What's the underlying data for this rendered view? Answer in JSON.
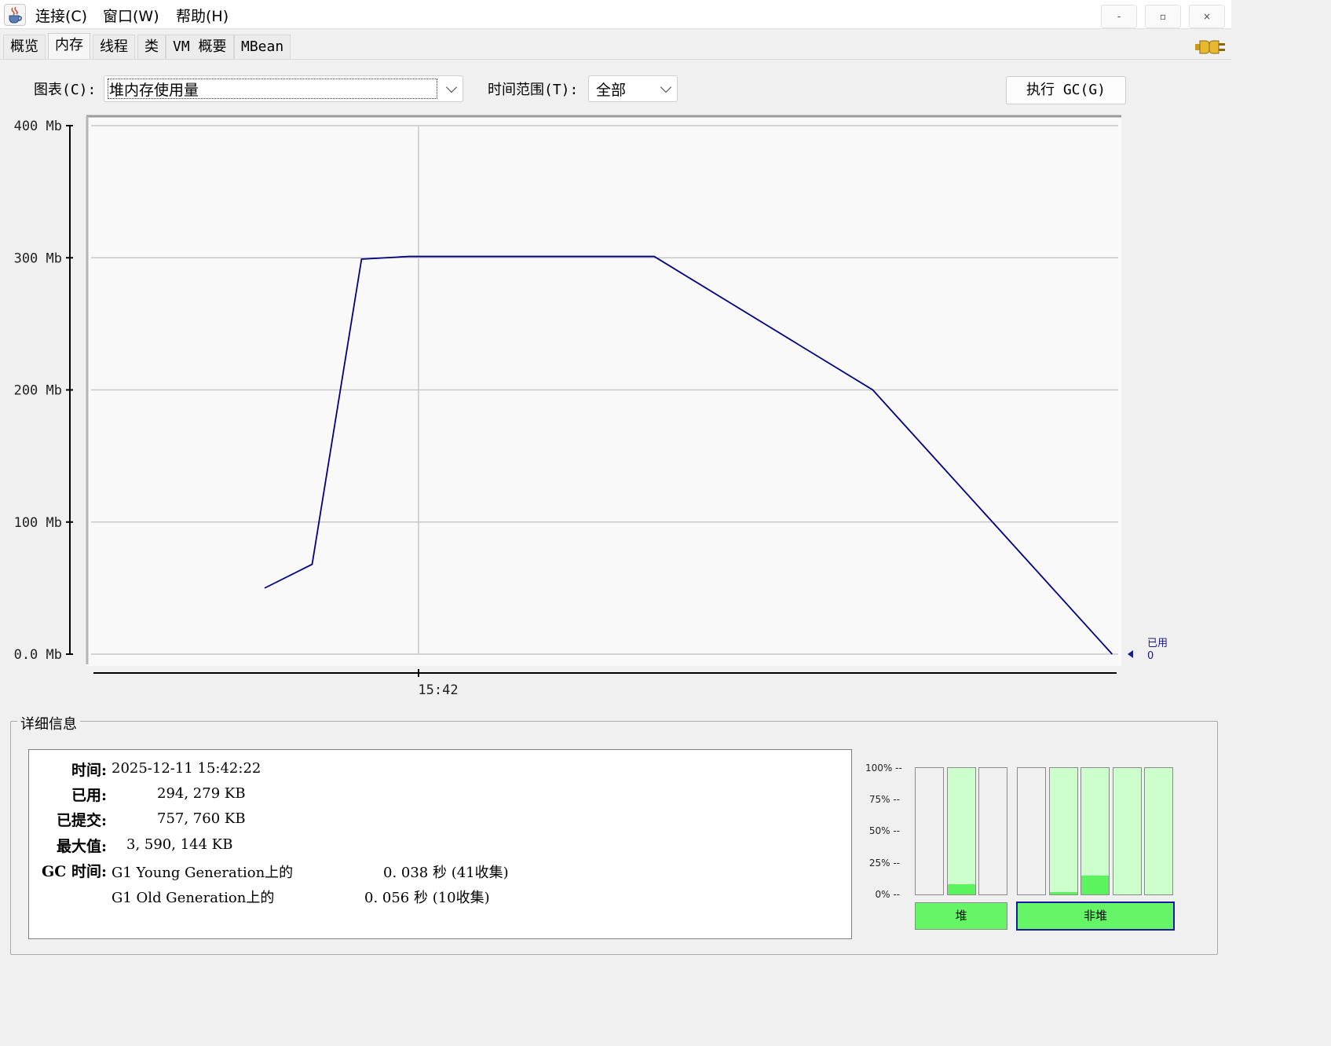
{
  "menu": {
    "items": [
      "连接(C)",
      "窗口(W)",
      "帮助(H)"
    ]
  },
  "window_controls": {
    "minimize": "-",
    "restore": "▫",
    "close": "×"
  },
  "tabs": [
    "概览",
    "内存",
    "线程",
    "类",
    "VM 概要",
    "MBean"
  ],
  "active_tab": "内存",
  "controls": {
    "chart_label": "图表(C):",
    "chart_value": "堆内存使用量",
    "range_label": "时间范围(T):",
    "range_value": "全部",
    "gc_button": "执行 GC(G)"
  },
  "chart_data": {
    "type": "line",
    "y_ticks": [
      "400 Mb",
      "300 Mb",
      "200 Mb",
      "100 Mb",
      "0.0 Mb"
    ],
    "ylim": [
      0,
      400
    ],
    "x_tick_labels": [
      "15:42"
    ],
    "grid": true,
    "line_color": "#000080",
    "series": [
      {
        "name": "已用",
        "points": [
          [
            0.0,
            50
          ],
          [
            0.25,
            68
          ],
          [
            0.51,
            299
          ],
          [
            0.76,
            301
          ],
          [
            2.05,
            301
          ],
          [
            3.2,
            200
          ],
          [
            4.46,
            0
          ]
        ]
      }
    ],
    "x_marker_label": "15:42",
    "legend": {
      "label": "已用",
      "value": "0",
      "position": "right"
    }
  },
  "details": {
    "title": "详细信息",
    "rows": [
      {
        "label": "时间:",
        "value": "2025-12-11 15:42:22"
      },
      {
        "label": "已用:",
        "value": "294, 279 KB"
      },
      {
        "label": "已提交:",
        "value": "757, 760 KB"
      },
      {
        "label": "最大值:",
        "value": "3, 590, 144 KB"
      }
    ],
    "gc_label": "GC 时间:",
    "gc": [
      {
        "name": "G1 Young Generation上的",
        "time": "0. 038 秒 (41收集)"
      },
      {
        "name": "G1 Old Generation上的",
        "time": "0. 056 秒 (10收集)"
      }
    ]
  },
  "pools": {
    "percent_ticks": [
      "100% --",
      "75% --",
      "50% --",
      "25% --",
      "0% --"
    ],
    "heap_label": "堆",
    "nonheap_label": "非堆",
    "bars": [
      {
        "group": "heap",
        "fill": 0.0,
        "committed": false
      },
      {
        "group": "heap",
        "fill": 0.08,
        "committed": true
      },
      {
        "group": "heap",
        "fill": 0.0,
        "committed": false
      },
      {
        "group": "nonheap",
        "fill": 0.0,
        "committed": false
      },
      {
        "group": "nonheap",
        "fill": 0.02,
        "committed": true
      },
      {
        "group": "nonheap",
        "fill": 0.15,
        "committed": true
      },
      {
        "group": "nonheap",
        "fill": 0.0,
        "committed": true
      },
      {
        "group": "nonheap",
        "fill": 0.0,
        "committed": true
      }
    ],
    "colors": {
      "used": "#5cf45c",
      "committed": "#ccffcc",
      "empty": "#f0f0f0"
    }
  }
}
